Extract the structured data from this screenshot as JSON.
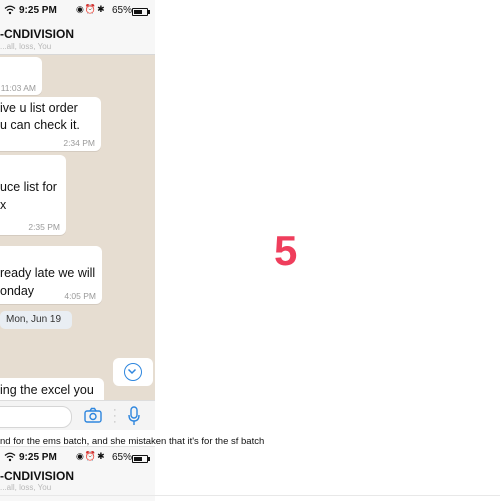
{
  "top_phone": {
    "status": {
      "time": "9:25 PM",
      "battery_text": "65%",
      "battery_level": 0.65,
      "icons": [
        "wifi-icon",
        "lock-rotation-icon",
        "alarm-icon",
        "bluetooth-icon",
        "battery-icon"
      ]
    },
    "header": {
      "title": "-CNDIVISION",
      "subtitle": "...all, loss, You"
    },
    "messages": [
      {
        "lines": [],
        "time": "11:03 AM"
      },
      {
        "lines": [
          "ive u list order",
          "u can check it."
        ],
        "time": "2:34 PM"
      },
      {
        "lines": [
          "uce list for",
          "x"
        ],
        "time": "2:35 PM"
      },
      {
        "lines": [
          "ready late we will",
          "onday"
        ],
        "time": "4:05 PM"
      }
    ],
    "date_divider": "Mon, Jun 19",
    "last_partial_message": "ing the excel you",
    "composer": {
      "camera_icon": "camera-icon",
      "mic_icon": "microphone-icon"
    }
  },
  "slide_number": "5",
  "caption": "nd for the ems batch, and she mistaken that it's for the sf batch",
  "bottom_phone": {
    "status": {
      "time": "9:25 PM",
      "battery_text": "65%",
      "battery_level": 0.65
    },
    "header": {
      "title": "-CNDIVISION",
      "subtitle": "...all, loss, You"
    }
  },
  "colors": {
    "chat_background": "#e6ddd1",
    "accent_blue": "#2e86de",
    "slide_number": "#ef3e5c"
  }
}
